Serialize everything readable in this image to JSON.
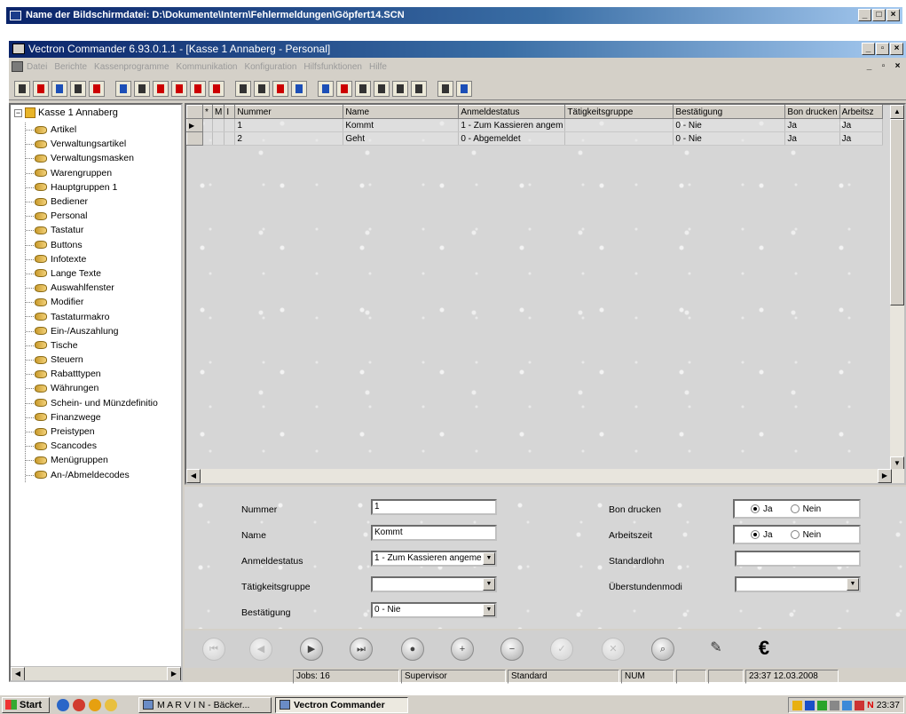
{
  "outer_window": {
    "title": "Name der Bildschirmdatei: D:\\Dokumente\\Intern\\Fehlermeldungen\\Göpfert14.SCN"
  },
  "app": {
    "title": "Vectron Commander 6.93.0.1.1 - [Kasse 1 Annaberg - Personal]",
    "menu": [
      "Datei",
      "Berichte",
      "Kassenprogramme",
      "Kommunikation",
      "Konfiguration",
      "Hilfsfunktionen",
      "Hilfe"
    ]
  },
  "tree": {
    "root": "Kasse 1 Annaberg",
    "items": [
      "Artikel",
      "Verwaltungsartikel",
      "Verwaltungsmasken",
      "Warengruppen",
      "Hauptgruppen 1",
      "Bediener",
      "Personal",
      "Tastatur",
      "Buttons",
      "Infotexte",
      "Lange Texte",
      "Auswahlfenster",
      "Modifier",
      "Tastaturmakro",
      "Ein-/Auszahlung",
      "Tische",
      "Steuern",
      "Rabatttypen",
      "Währungen",
      "Schein- und Münzdefinitio",
      "Finanzwege",
      "Preistypen",
      "Scancodes",
      "Menügruppen",
      "An-/Abmeldecodes"
    ]
  },
  "grid": {
    "columns": [
      "*",
      "M",
      "I",
      "Nummer",
      "Name",
      "Anmeldestatus",
      "Tätigkeitsgruppe",
      "Bestätigung",
      "Bon drucken",
      "Arbeitsz"
    ],
    "rows": [
      {
        "indicator": "▶",
        "nummer": "1",
        "name": "Kommt",
        "anmeldestatus": "1 - Zum Kassieren angem",
        "taetigkeitsgruppe": "",
        "bestaetigung": "0 - Nie",
        "bon_drucken": "Ja",
        "arbeitszeit": "Ja"
      },
      {
        "indicator": "",
        "nummer": "2",
        "name": "Geht",
        "anmeldestatus": "0 - Abgemeldet",
        "taetigkeitsgruppe": "",
        "bestaetigung": "0 - Nie",
        "bon_drucken": "Ja",
        "arbeitszeit": "Ja"
      }
    ]
  },
  "form": {
    "nummer": {
      "label": "Nummer",
      "value": "1"
    },
    "name": {
      "label": "Name",
      "value": "Kommt"
    },
    "anmeldestatus": {
      "label": "Anmeldestatus",
      "value": "1 - Zum Kassieren angeme"
    },
    "taetigkeitsgruppe": {
      "label": "Tätigkeitsgruppe",
      "value": ""
    },
    "bestaetigung": {
      "label": "Bestätigung",
      "value": "0 - Nie"
    },
    "bon_drucken": {
      "label": "Bon drucken",
      "options": [
        "Ja",
        "Nein"
      ],
      "selected": "Ja"
    },
    "arbeitszeit": {
      "label": "Arbeitszeit",
      "options": [
        "Ja",
        "Nein"
      ],
      "selected": "Ja"
    },
    "standardlohn": {
      "label": "Standardlohn",
      "value": ""
    },
    "ueberstundenmodi": {
      "label": "Überstundenmodi",
      "value": ""
    }
  },
  "nav_icons": [
    "first-icon",
    "previous-icon",
    "play-icon",
    "next-icon",
    "record-icon",
    "add-icon",
    "remove-icon",
    "confirm-icon",
    "cancel-icon",
    "search-icon",
    "edit-icon",
    "euro-icon"
  ],
  "status": {
    "jobs": "Jobs: 16",
    "user": "Supervisor",
    "mode": "Standard",
    "num": "NUM",
    "datetime": "23:37 12.03.2008"
  },
  "taskbar": {
    "start": "Start",
    "tasks": [
      "M A R V I N - Bäcker...",
      "Vectron Commander"
    ],
    "clock": "23:37"
  }
}
